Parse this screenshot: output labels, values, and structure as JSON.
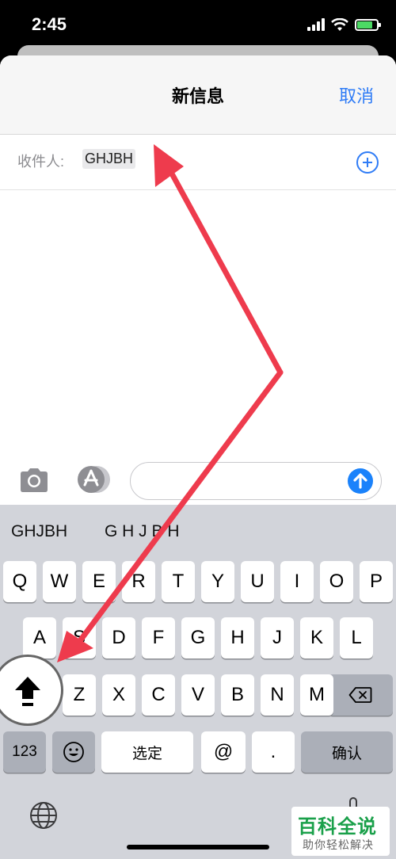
{
  "status": {
    "time": "2:45",
    "icons": [
      "signal-icon",
      "wifi-icon",
      "battery-charging-icon"
    ],
    "battery_level": 0.8
  },
  "nav": {
    "title": "新信息",
    "cancel_label": "取消"
  },
  "recipient": {
    "label": "收件人:",
    "value": "GHJBH",
    "add_icon": "plus-circle-icon"
  },
  "compose": {
    "camera_icon": "camera-icon",
    "apps_icon": "app-store-icon",
    "message_value": "",
    "send_icon": "arrow-up-icon"
  },
  "keyboard": {
    "suggestions": [
      "GHJBH",
      "G H J B H"
    ],
    "row1": [
      "Q",
      "W",
      "E",
      "R",
      "T",
      "Y",
      "U",
      "I",
      "O",
      "P"
    ],
    "row2": [
      "A",
      "S",
      "D",
      "F",
      "G",
      "H",
      "J",
      "K",
      "L"
    ],
    "row3": [
      "Z",
      "X",
      "C",
      "V",
      "B",
      "N",
      "M"
    ],
    "numbers_label": "123",
    "space_label": "选定",
    "at_label": "@",
    "period_label": ".",
    "confirm_label": "确认",
    "shift_icon": "shift-icon",
    "backspace_icon": "backspace-icon",
    "emoji_icon": "emoji-icon",
    "globe_icon": "globe-icon",
    "mic_icon": "microphone-icon"
  },
  "watermark": {
    "title": "百科全说",
    "subtitle": "助你轻松解决"
  },
  "colors": {
    "accent": "#2f7cf6",
    "send": "#1a82fb",
    "annotation_arrow": "#ee3b4d",
    "keyboard_bg": "#d2d4da",
    "battery": "#4cd964"
  }
}
